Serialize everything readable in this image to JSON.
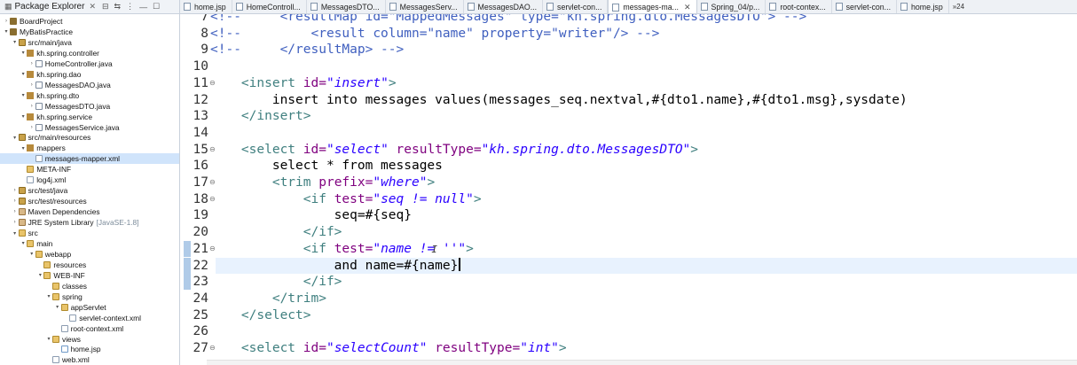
{
  "explorer": {
    "title": "Package Explorer",
    "tree": [
      {
        "label": "BoardProject",
        "icon": "project",
        "indent": 0,
        "arrow": "right"
      },
      {
        "label": "MyBatisPractice",
        "icon": "project",
        "indent": 0,
        "arrow": "down"
      },
      {
        "label": "src/main/java",
        "icon": "source",
        "indent": 1,
        "arrow": "down"
      },
      {
        "label": "kh.spring.controller",
        "icon": "package",
        "indent": 2,
        "arrow": "down"
      },
      {
        "label": "HomeController.java",
        "icon": "java",
        "indent": 3,
        "arrow": "right"
      },
      {
        "label": "kh.spring.dao",
        "icon": "package",
        "indent": 2,
        "arrow": "down"
      },
      {
        "label": "MessagesDAO.java",
        "icon": "java",
        "indent": 3,
        "arrow": "right"
      },
      {
        "label": "kh.spring.dto",
        "icon": "package",
        "indent": 2,
        "arrow": "down"
      },
      {
        "label": "MessagesDTO.java",
        "icon": "java",
        "indent": 3,
        "arrow": "right"
      },
      {
        "label": "kh.spring.service",
        "icon": "package",
        "indent": 2,
        "arrow": "down"
      },
      {
        "label": "MessagesService.java",
        "icon": "java",
        "indent": 3,
        "arrow": "right"
      },
      {
        "label": "src/main/resources",
        "icon": "source",
        "indent": 1,
        "arrow": "down"
      },
      {
        "label": "mappers",
        "icon": "package",
        "indent": 2,
        "arrow": "down"
      },
      {
        "label": "messages-mapper.xml",
        "icon": "xml",
        "indent": 3,
        "arrow": "",
        "selected": true
      },
      {
        "label": "META-INF",
        "icon": "folder",
        "indent": 2,
        "arrow": ""
      },
      {
        "label": "log4j.xml",
        "icon": "xml",
        "indent": 2,
        "arrow": ""
      },
      {
        "label": "src/test/java",
        "icon": "source",
        "indent": 1,
        "arrow": "right"
      },
      {
        "label": "src/test/resources",
        "icon": "source",
        "indent": 1,
        "arrow": "right"
      },
      {
        "label": "Maven Dependencies",
        "icon": "library",
        "indent": 1,
        "arrow": "right"
      },
      {
        "label": "JRE System Library",
        "decor": "[JavaSE-1.8]",
        "icon": "library",
        "indent": 1,
        "arrow": "right"
      },
      {
        "label": "src",
        "icon": "folder",
        "indent": 1,
        "arrow": "down"
      },
      {
        "label": "main",
        "icon": "folder",
        "indent": 2,
        "arrow": "down"
      },
      {
        "label": "webapp",
        "icon": "folder",
        "indent": 3,
        "arrow": "down"
      },
      {
        "label": "resources",
        "icon": "folder",
        "indent": 4,
        "arrow": ""
      },
      {
        "label": "WEB-INF",
        "icon": "folder",
        "indent": 4,
        "arrow": "down"
      },
      {
        "label": "classes",
        "icon": "folder",
        "indent": 5,
        "arrow": ""
      },
      {
        "label": "spring",
        "icon": "folder",
        "indent": 5,
        "arrow": "down"
      },
      {
        "label": "appServlet",
        "icon": "folder",
        "indent": 6,
        "arrow": "down"
      },
      {
        "label": "servlet-context.xml",
        "icon": "xml",
        "indent": 7,
        "arrow": ""
      },
      {
        "label": "root-context.xml",
        "icon": "xml",
        "indent": 6,
        "arrow": ""
      },
      {
        "label": "views",
        "icon": "folder",
        "indent": 5,
        "arrow": "down"
      },
      {
        "label": "home.jsp",
        "icon": "jsp",
        "indent": 6,
        "arrow": ""
      },
      {
        "label": "web.xml",
        "icon": "xml",
        "indent": 5,
        "arrow": ""
      }
    ]
  },
  "tabs": [
    {
      "label": "home.jsp"
    },
    {
      "label": "HomeControll..."
    },
    {
      "label": "MessagesDTO..."
    },
    {
      "label": "MessagesServ..."
    },
    {
      "label": "MessagesDAO..."
    },
    {
      "label": "servlet-con..."
    },
    {
      "label": "messages-ma...",
      "active": true
    },
    {
      "label": "Spring_04/p..."
    },
    {
      "label": "root-contex..."
    },
    {
      "label": "servlet-con..."
    },
    {
      "label": "home.jsp"
    }
  ],
  "tabs_overflow": "»24",
  "editor": {
    "current_line": 22,
    "lines": [
      {
        "n": "7",
        "fold": "",
        "tokens": [
          [
            "c",
            "<!--     <resultMap id=\"MappedMessages\" type=\"kh.spring.dto.MessagesDTO\"> -->"
          ]
        ]
      },
      {
        "n": "8",
        "fold": "",
        "tokens": [
          [
            "c",
            "<!--         <result column=\"name\" property=\"writer\"/> -->"
          ]
        ]
      },
      {
        "n": "9",
        "fold": "",
        "tokens": [
          [
            "c",
            "<!--     </resultMap> -->"
          ]
        ]
      },
      {
        "n": "10",
        "fold": "",
        "tokens": []
      },
      {
        "n": "11",
        "fold": "⊖",
        "tokens": [
          [
            "p",
            "    "
          ],
          [
            "t",
            "<insert "
          ],
          [
            "a",
            "id="
          ],
          [
            "v",
            "\"insert\""
          ],
          [
            "t",
            ">"
          ]
        ]
      },
      {
        "n": "12",
        "fold": "",
        "tokens": [
          [
            "p",
            "        insert into messages values(messages_seq.nextval,#{dto1.name},#{dto1.msg},sysdate)"
          ]
        ]
      },
      {
        "n": "13",
        "fold": "",
        "tokens": [
          [
            "p",
            "    "
          ],
          [
            "t",
            "</insert>"
          ]
        ]
      },
      {
        "n": "14",
        "fold": "",
        "tokens": []
      },
      {
        "n": "15",
        "fold": "⊖",
        "tokens": [
          [
            "p",
            "    "
          ],
          [
            "t",
            "<select "
          ],
          [
            "a",
            "id="
          ],
          [
            "v",
            "\"select\""
          ],
          [
            "p",
            " "
          ],
          [
            "a",
            "resultType="
          ],
          [
            "v",
            "\"kh.spring.dto.MessagesDTO\""
          ],
          [
            "t",
            ">"
          ]
        ]
      },
      {
        "n": "16",
        "fold": "",
        "tokens": [
          [
            "p",
            "        select * from messages"
          ]
        ]
      },
      {
        "n": "17",
        "fold": "⊖",
        "tokens": [
          [
            "p",
            "        "
          ],
          [
            "t",
            "<trim "
          ],
          [
            "a",
            "prefix="
          ],
          [
            "v",
            "\"where\""
          ],
          [
            "t",
            ">"
          ]
        ]
      },
      {
        "n": "18",
        "fold": "⊖",
        "tokens": [
          [
            "p",
            "            "
          ],
          [
            "t",
            "<if "
          ],
          [
            "a",
            "test="
          ],
          [
            "v",
            "\"seq != null\""
          ],
          [
            "t",
            ">"
          ]
        ]
      },
      {
        "n": "19",
        "fold": "",
        "tokens": [
          [
            "p",
            "                seq=#{seq}"
          ]
        ]
      },
      {
        "n": "20",
        "fold": "",
        "tokens": [
          [
            "p",
            "            "
          ],
          [
            "t",
            "</if>"
          ]
        ]
      },
      {
        "n": "21",
        "fold": "⊖",
        "tokens": [
          [
            "p",
            "            "
          ],
          [
            "t",
            "<if "
          ],
          [
            "a",
            "test="
          ],
          [
            "v",
            "\"name != ''\""
          ],
          [
            "t",
            ">"
          ]
        ]
      },
      {
        "n": "22",
        "fold": "",
        "tokens": [
          [
            "p",
            "                and name=#{name}"
          ]
        ]
      },
      {
        "n": "23",
        "fold": "",
        "tokens": [
          [
            "p",
            "            "
          ],
          [
            "t",
            "</if>"
          ]
        ]
      },
      {
        "n": "24",
        "fold": "",
        "tokens": [
          [
            "p",
            "        "
          ],
          [
            "t",
            "</trim>"
          ]
        ]
      },
      {
        "n": "25",
        "fold": "",
        "tokens": [
          [
            "p",
            "    "
          ],
          [
            "t",
            "</select>"
          ]
        ]
      },
      {
        "n": "26",
        "fold": "",
        "tokens": []
      },
      {
        "n": "27",
        "fold": "⊖",
        "tokens": [
          [
            "p",
            "    "
          ],
          [
            "t",
            "<select "
          ],
          [
            "a",
            "id="
          ],
          [
            "v",
            "\"selectCount\""
          ],
          [
            "p",
            " "
          ],
          [
            "a",
            "resultType="
          ],
          [
            "v",
            "\"int\""
          ],
          [
            "t",
            ">"
          ]
        ]
      }
    ]
  },
  "colors": {
    "tag": "#3f7f7f",
    "attribute": "#7f007f",
    "value": "#2a00ff",
    "comment": "#3f5fbf",
    "selection": "#d0e4fb"
  }
}
